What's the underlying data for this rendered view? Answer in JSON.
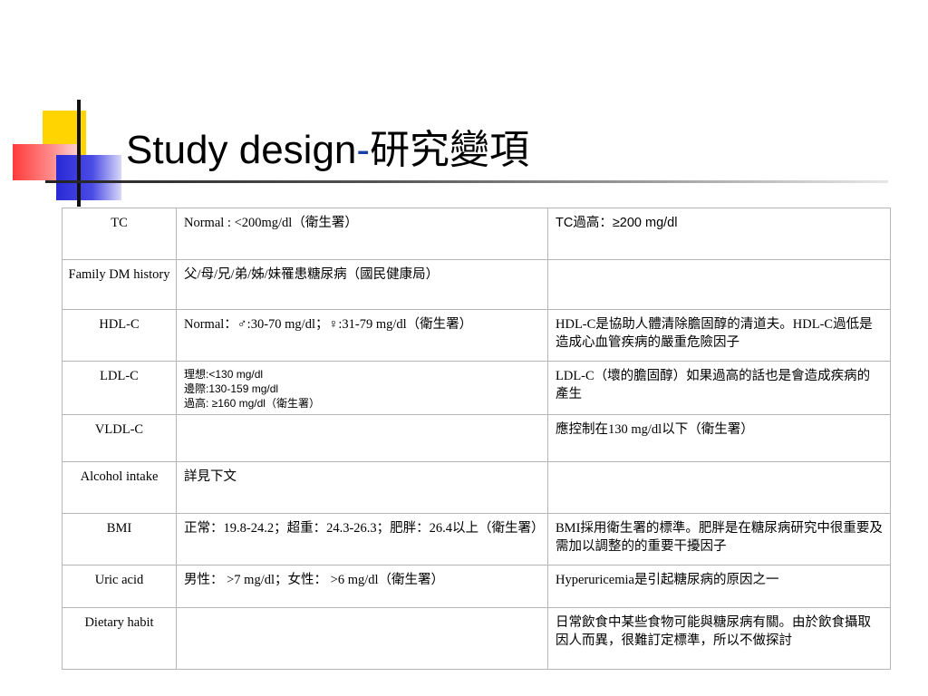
{
  "slide": {
    "title_main": "Study design",
    "title_separator": "-",
    "title_cjk": "研究變項"
  },
  "table": {
    "rows": [
      {
        "variable": "TC",
        "definition": "Normal : <200mg/dl（衛生署）",
        "note": "TC過高：≥200 mg/dl"
      },
      {
        "variable": "Family DM history",
        "definition": "父/母/兄/弟/姊/妹罹患糖尿病（國民健康局）",
        "note": ""
      },
      {
        "variable": "HDL-C",
        "definition": "Normal：♂:30-70 mg/dl；♀:31-79 mg/dl（衛生署）",
        "note": "HDL-C是協助人體清除膽固醇的清道夫。HDL-C過低是造成心血管疾病的嚴重危險因子"
      },
      {
        "variable": "LDL-C",
        "definition_lines": [
          "理想:<130 mg/dl",
          "邊際:130-159 mg/dl",
          "過高: ≥160 mg/dl（衛生署）"
        ],
        "note": "LDL-C（壞的膽固醇）如果過高的話也是會造成疾病的產生"
      },
      {
        "variable": "VLDL-C",
        "definition": "",
        "note": "應控制在130 mg/dl以下（衛生署）"
      },
      {
        "variable": "Alcohol intake",
        "definition": "詳見下文",
        "note": ""
      },
      {
        "variable": "BMI",
        "definition": "正常：19.8-24.2；超重：24.3-26.3；肥胖：26.4以上（衛生署）",
        "note": "BMI採用衛生署的標準。肥胖是在糖尿病研究中很重要及需加以調整的的重要干擾因子"
      },
      {
        "variable": "Uric acid",
        "definition": "男性： >7 mg/dl；女性： >6 mg/dl（衛生署）",
        "note": "Hyperuricemia是引起糖尿病的原因之一"
      },
      {
        "variable": "Dietary habit",
        "definition": "",
        "note": "日常飲食中某些食物可能與糖尿病有關。由於飲食攝取因人而異，很難訂定標準，所以不做探討"
      }
    ]
  }
}
